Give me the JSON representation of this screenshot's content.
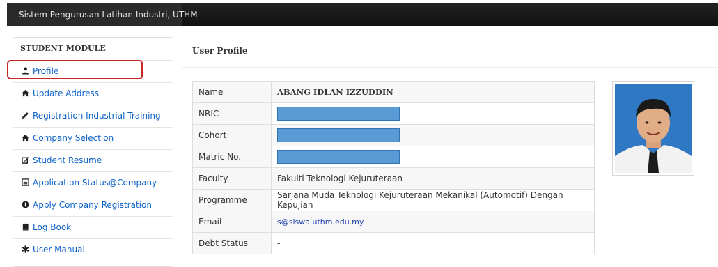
{
  "app": {
    "title": "Sistem Pengurusan Latihan Industri, UTHM"
  },
  "sidebar": {
    "title": "STUDENT MODULE",
    "items": [
      {
        "label": "Profile",
        "icon": "user-icon"
      },
      {
        "label": "Update Address",
        "icon": "home-icon"
      },
      {
        "label": "Registration Industrial Training",
        "icon": "pencil-icon"
      },
      {
        "label": "Company Selection",
        "icon": "home-icon"
      },
      {
        "label": "Student Resume",
        "icon": "edit-icon"
      },
      {
        "label": "Application Status@Company",
        "icon": "list-icon"
      },
      {
        "label": "Apply Company Registration",
        "icon": "info-icon"
      },
      {
        "label": "Log Book",
        "icon": "book-icon"
      },
      {
        "label": "User Manual",
        "icon": "asterisk-icon"
      }
    ],
    "active_item": "Profile"
  },
  "main": {
    "title": "User Profile",
    "profile": {
      "name": {
        "label": "Name",
        "value": "ABANG IDLAN IZZUDDIN"
      },
      "nric": {
        "label": "NRIC",
        "value": ""
      },
      "cohort": {
        "label": "Cohort",
        "value": ""
      },
      "matric": {
        "label": "Matric No.",
        "value": ""
      },
      "faculty": {
        "label": "Faculty",
        "value": "Fakulti Teknologi Kejuruteraan"
      },
      "programme": {
        "label": "Programme",
        "value": "Sarjana Muda Teknologi Kejuruteraan Mekanikal (Automotif) Dengan Kepujian"
      },
      "email": {
        "label": "Email",
        "value": "s@siswa.uthm.edu.my"
      },
      "debt": {
        "label": "Debt Status",
        "value": "-"
      }
    }
  },
  "colors": {
    "topbar": "#1b1b1b",
    "link": "#0e62c7",
    "highlight": "#c62828",
    "redaction": "#5b9bd5"
  }
}
